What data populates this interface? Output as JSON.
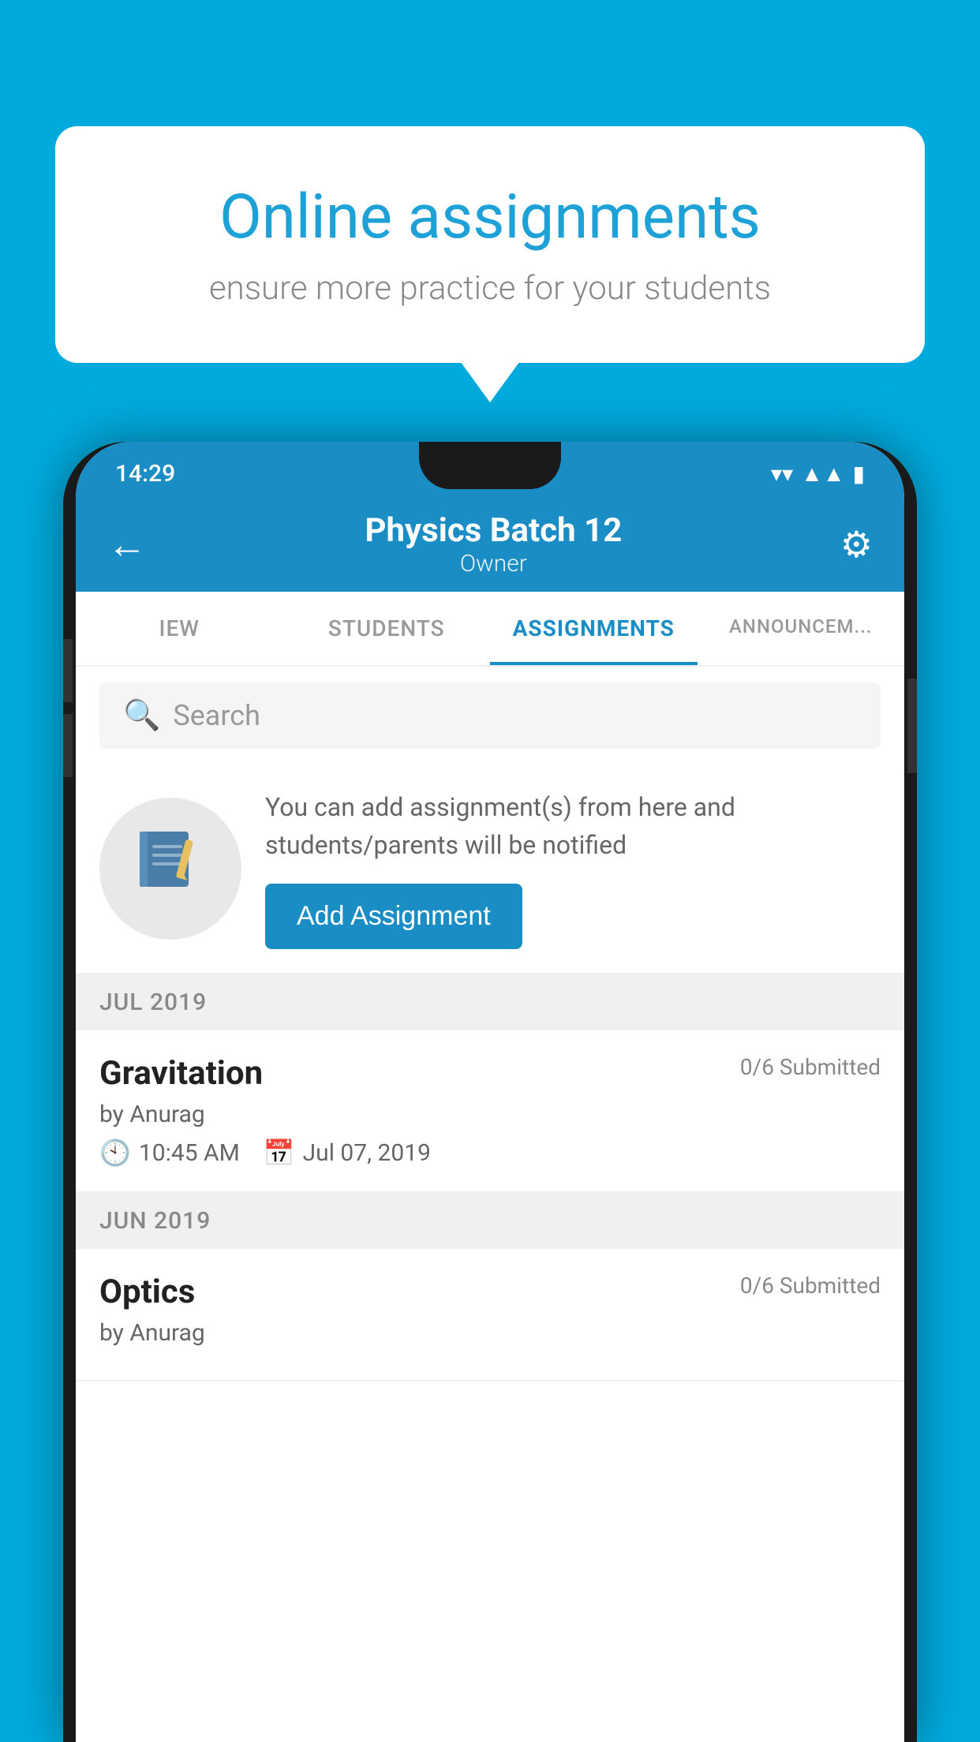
{
  "background_color": "#00AADD",
  "speech_bubble": {
    "title": "Online assignments",
    "subtitle": "ensure more practice for your students"
  },
  "status_bar": {
    "time": "14:29",
    "wifi": "▼",
    "signal": "▲",
    "battery": "▮"
  },
  "app_header": {
    "title": "Physics Batch 12",
    "subtitle": "Owner",
    "back_icon": "←",
    "settings_icon": "⚙"
  },
  "tabs": [
    {
      "label": "IEW",
      "active": false
    },
    {
      "label": "STUDENTS",
      "active": false
    },
    {
      "label": "ASSIGNMENTS",
      "active": true
    },
    {
      "label": "ANNOUNCEM...",
      "active": false
    }
  ],
  "search": {
    "placeholder": "Search",
    "icon": "🔍"
  },
  "promo_section": {
    "description": "You can add assignment(s) from here and students/parents will be notified",
    "button_label": "Add Assignment"
  },
  "sections": [
    {
      "header": "JUL 2019",
      "assignments": [
        {
          "title": "Gravitation",
          "submitted": "0/6 Submitted",
          "author": "by Anurag",
          "time": "10:45 AM",
          "date": "Jul 07, 2019"
        }
      ]
    },
    {
      "header": "JUN 2019",
      "assignments": [
        {
          "title": "Optics",
          "submitted": "0/6 Submitted",
          "author": "by Anurag",
          "time": "",
          "date": ""
        }
      ]
    }
  ]
}
